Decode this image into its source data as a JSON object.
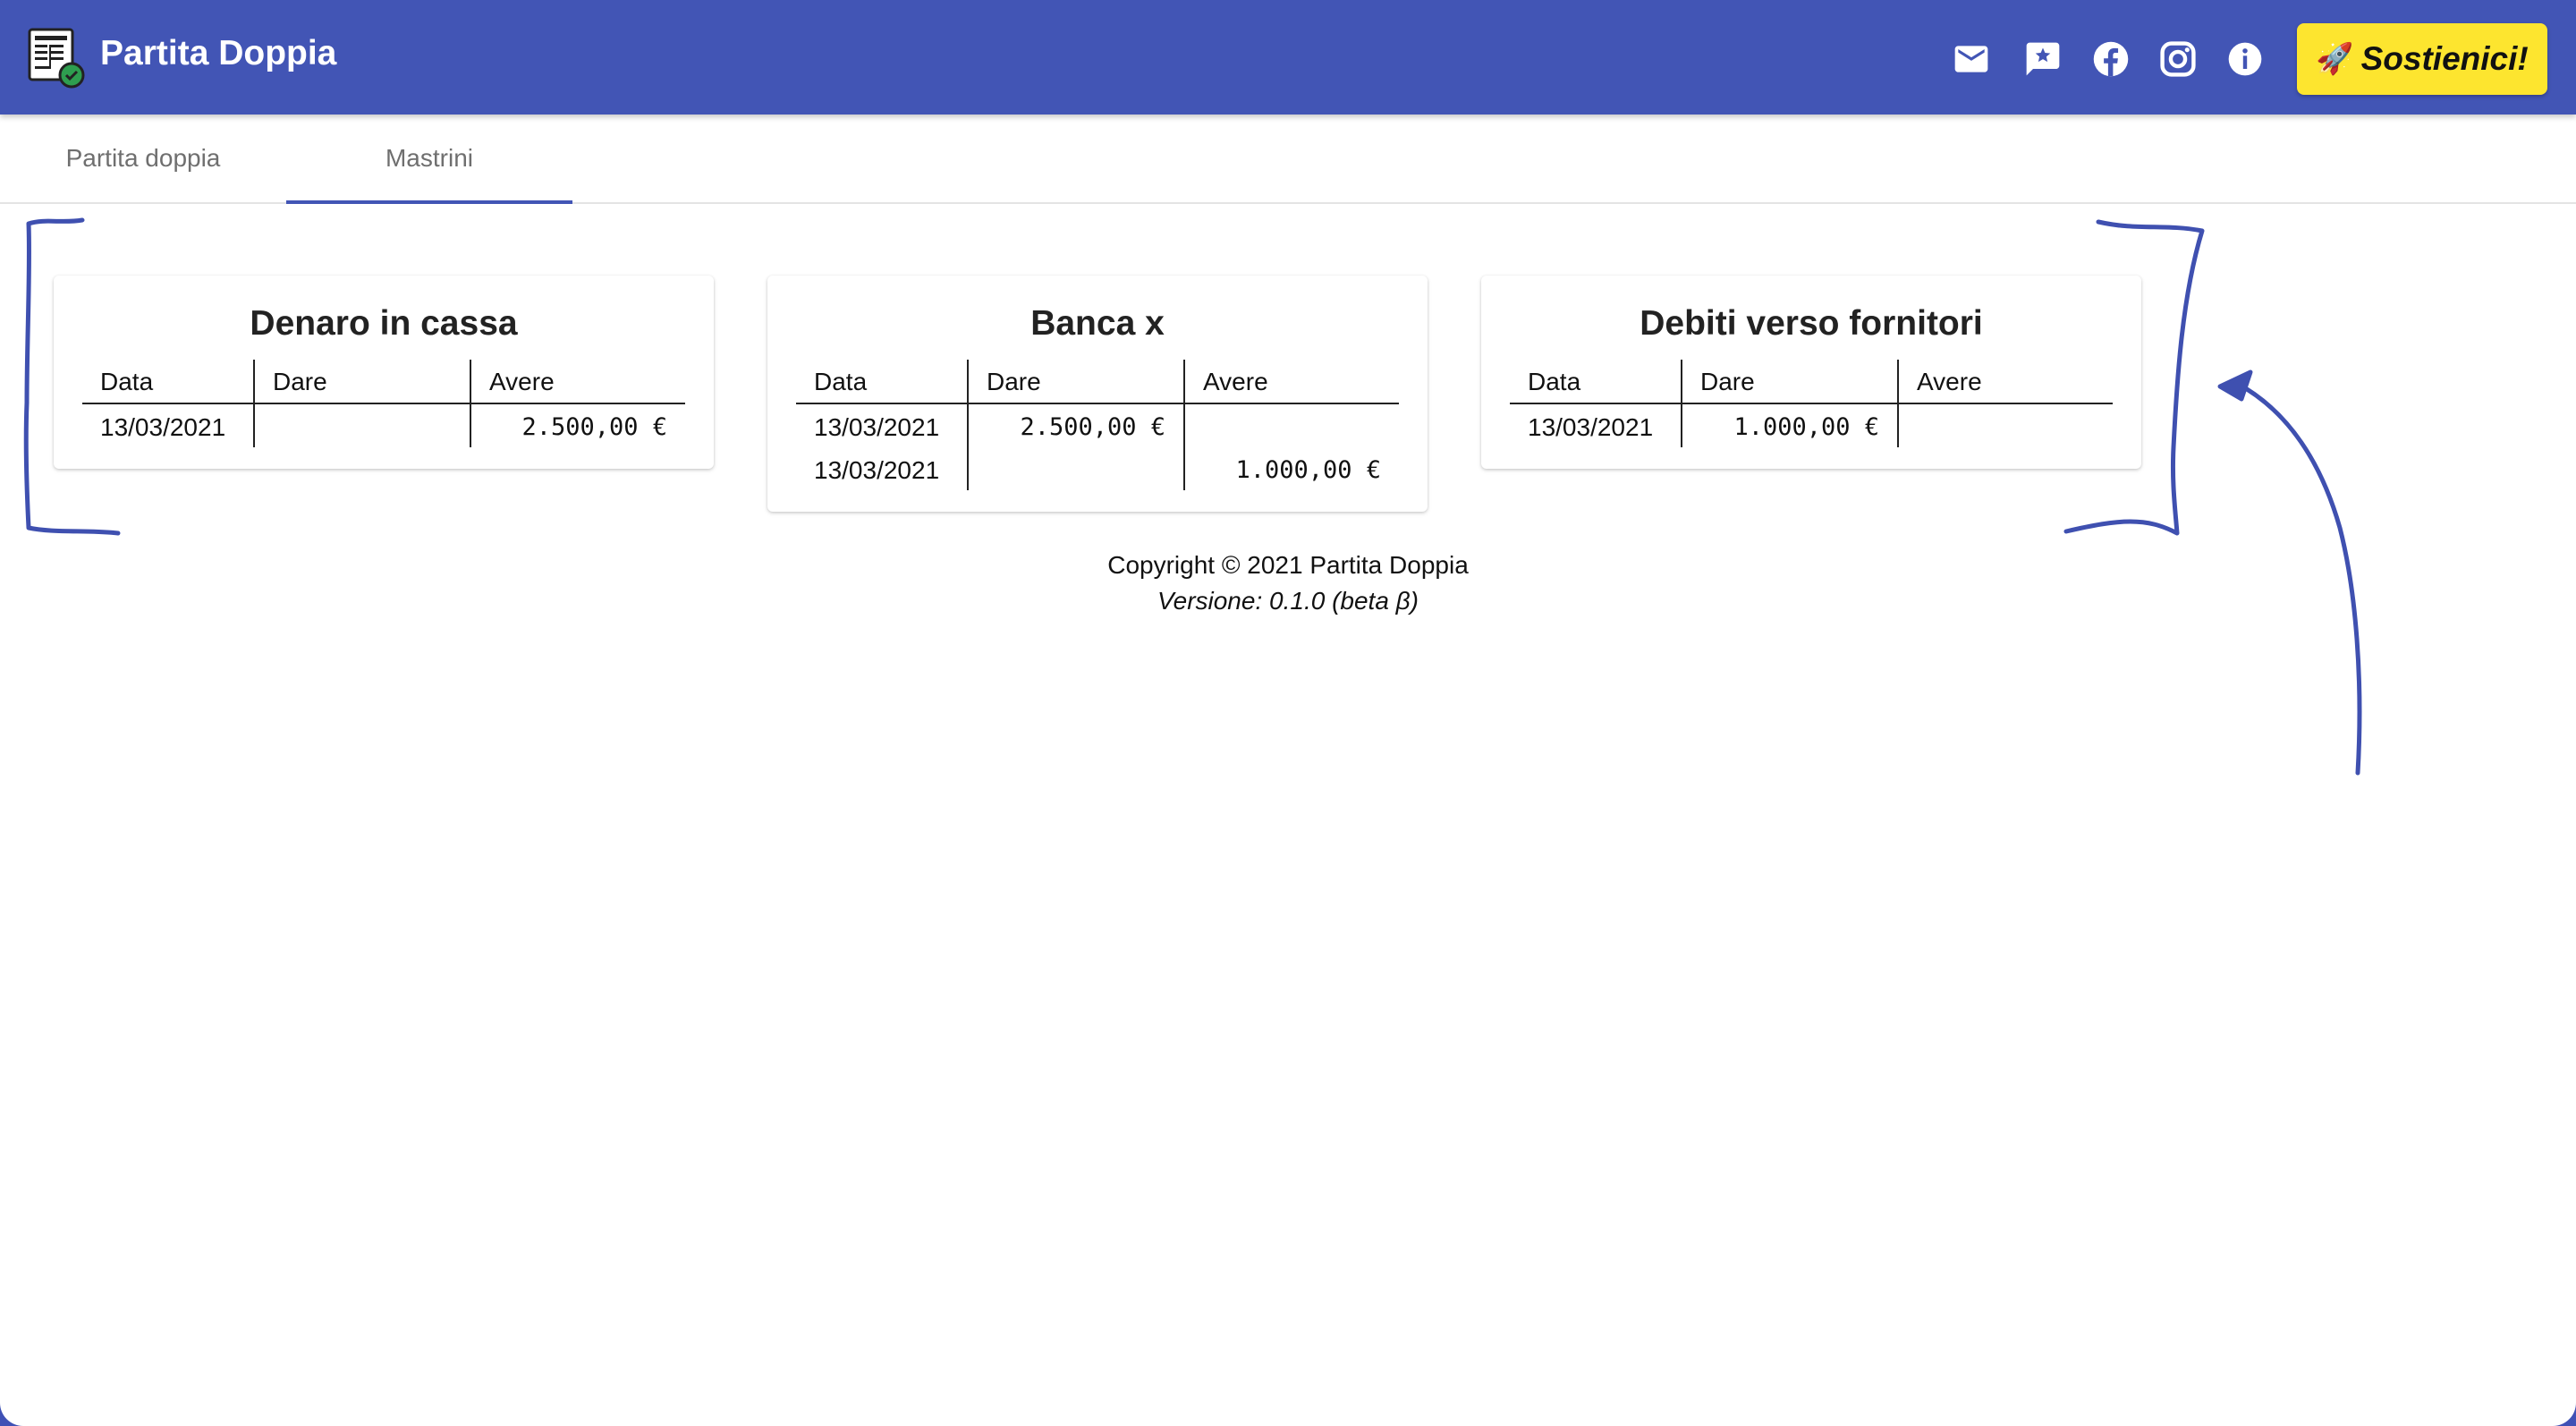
{
  "app": {
    "title": "Partita Doppia",
    "icons": [
      "mail-icon",
      "feedback-icon",
      "facebook-icon",
      "instagram-icon",
      "info-icon"
    ],
    "support_button": {
      "emoji": "🚀",
      "label": "Sostienici!"
    },
    "colors": {
      "primary": "#4255b5",
      "accent": "#fde52f"
    }
  },
  "tabs": [
    {
      "label": "Partita doppia",
      "active": false
    },
    {
      "label": "Mastrini",
      "active": true
    }
  ],
  "ledger_columns": {
    "data": "Data",
    "dare": "Dare",
    "avere": "Avere"
  },
  "accounts": [
    {
      "title": "Denaro in cassa",
      "rows": [
        {
          "date": "13/03/2021",
          "dare": "",
          "avere": "2.500,00 €"
        }
      ]
    },
    {
      "title": "Banca x",
      "rows": [
        {
          "date": "13/03/2021",
          "dare": "2.500,00 €",
          "avere": ""
        },
        {
          "date": "13/03/2021",
          "dare": "",
          "avere": "1.000,00 €"
        }
      ]
    },
    {
      "title": "Debiti verso fornitori",
      "rows": [
        {
          "date": "13/03/2021",
          "dare": "1.000,00 €",
          "avere": ""
        }
      ]
    }
  ],
  "footer": {
    "copyright": "Copyright © 2021 Partita Doppia",
    "version": "Versione: 0.1.0 (beta β)"
  }
}
